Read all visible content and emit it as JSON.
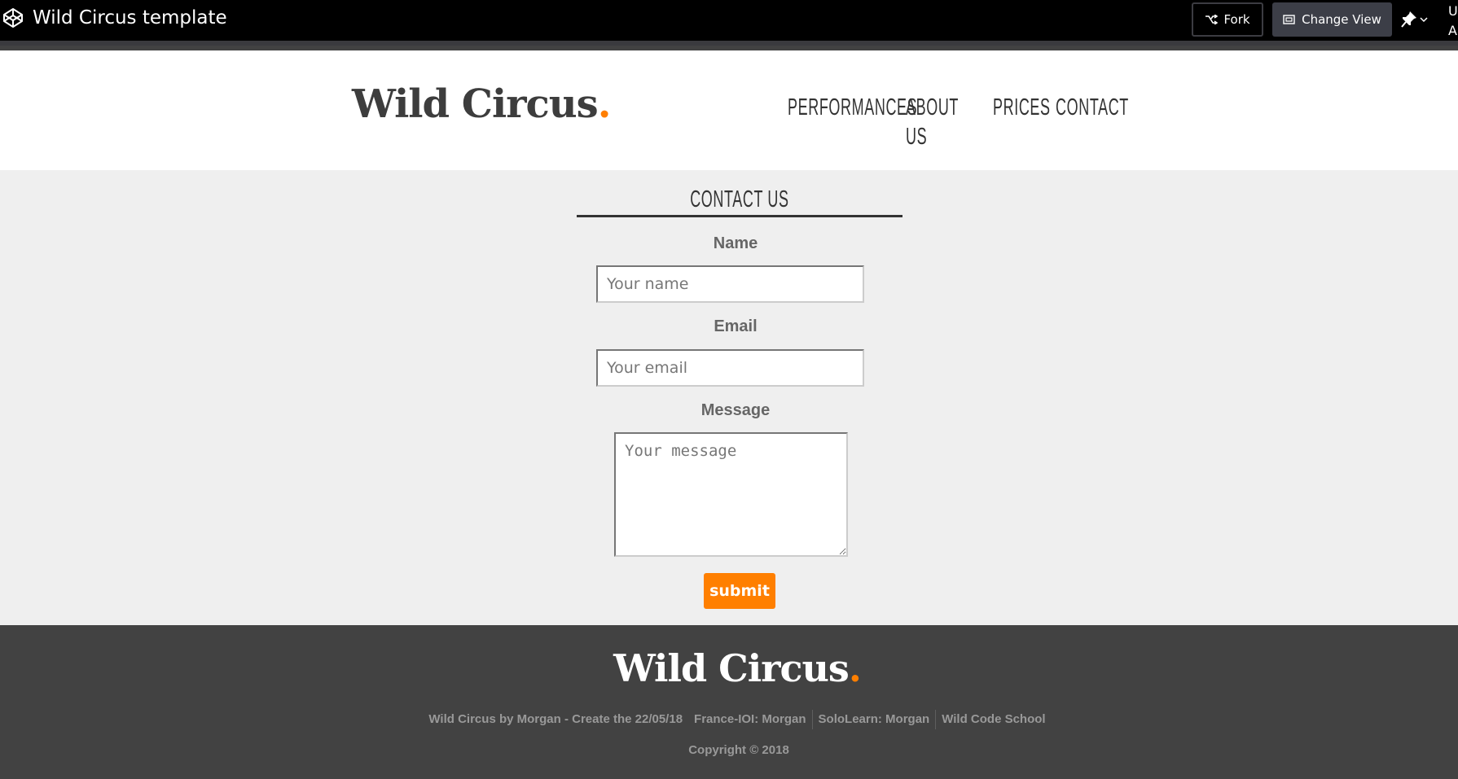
{
  "codepen_bar": {
    "title": "Wild Circus template",
    "fork_label": "Fork",
    "change_view_label": "Change View",
    "edge_text": "U A"
  },
  "header": {
    "brand": "Wild Circus",
    "brand_dot": ".",
    "nav": [
      {
        "label": "PERFORMANCES"
      },
      {
        "label": "ABOUT US"
      },
      {
        "label": "PRICES"
      },
      {
        "label": "CONTACT"
      }
    ]
  },
  "contact": {
    "title": "CONTACT US",
    "name_label": "Name",
    "name_placeholder": "Your name",
    "email_label": "Email",
    "email_placeholder": "Your email",
    "message_label": "Message",
    "message_placeholder": "Your message",
    "submit_label": "submit"
  },
  "footer": {
    "brand": "Wild Circus",
    "brand_dot": ".",
    "links": [
      "Wild Circus by Morgan - Create the 22/05/18",
      "France-IOI: Morgan",
      "SoloLearn: Morgan",
      "Wild Code School"
    ],
    "copyright": "Copyright © 2018"
  },
  "colors": {
    "accent": "#ff7f00",
    "header_bg": "#ffffff",
    "section_bg": "#efefef",
    "footer_bg": "#424242",
    "topbar_bg": "#000000"
  }
}
